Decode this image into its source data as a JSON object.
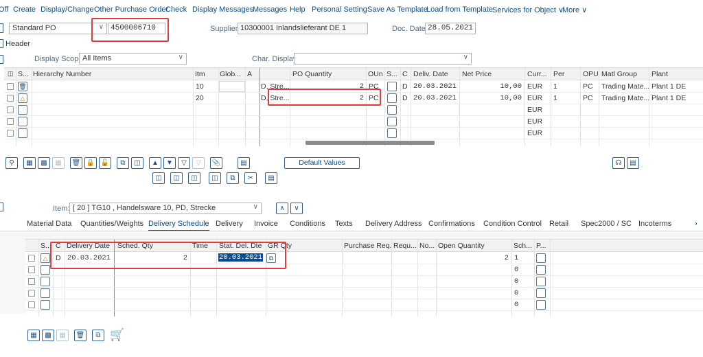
{
  "menu": {
    "off": "Off",
    "items": [
      "Create",
      "Display/Change",
      "Other Purchase Order",
      "Check",
      "Display Messages",
      "Messages",
      "Help",
      "Personal Setting",
      "Save As Template",
      "Load from Template",
      "Services for Object",
      "More"
    ]
  },
  "header": {
    "po_type": "Standard PO",
    "po_number": "4500006710",
    "supplier_label": "Supplier:",
    "supplier_value": "10300001 Inlandslieferant DE 1",
    "doc_date_label": "Doc. Date:",
    "doc_date_value": "28.05.2021",
    "header_label": "Header",
    "display_scope_label": "Display Scope:",
    "display_scope_value": "All Items",
    "char_display_label": "Char. Display:",
    "char_display_value": ""
  },
  "items_table": {
    "columns": [
      "S...",
      "Hierarchy Number",
      "Itm",
      "Glob...",
      "A",
      "PO Quantity",
      "OUn",
      "S...",
      "C",
      "Deliv. Date",
      "Net Price",
      "Curr...",
      "Per",
      "OPU",
      "Matl Group",
      "Plant"
    ],
    "rows": [
      {
        "status": "trash",
        "itm": "10",
        "a": "D, Stre...",
        "qty": "2",
        "oun": "PC",
        "c": "D",
        "date": "20.03.2021",
        "price": "10,00",
        "curr": "EUR",
        "per": "1",
        "opu": "PC",
        "matl": "Trading Mate...",
        "plant": "Plant 1 DE"
      },
      {
        "status": "warning",
        "itm": "20",
        "a": "D, Stre...",
        "qty": "2",
        "oun": "PC",
        "c": "D",
        "date": "20.03.2021",
        "price": "10,00",
        "curr": "EUR",
        "per": "1",
        "opu": "PC",
        "matl": "Trading Mate...",
        "plant": "Plant 1 DE"
      },
      {
        "status": "",
        "itm": "",
        "a": "",
        "qty": "",
        "oun": "",
        "c": "",
        "date": "",
        "price": "",
        "curr": "EUR",
        "per": "",
        "opu": "",
        "matl": "",
        "plant": ""
      },
      {
        "status": "",
        "itm": "",
        "a": "",
        "qty": "",
        "oun": "",
        "c": "",
        "date": "",
        "price": "",
        "curr": "EUR",
        "per": "",
        "opu": "",
        "matl": "",
        "plant": ""
      },
      {
        "status": "",
        "itm": "",
        "a": "",
        "qty": "",
        "oun": "",
        "c": "",
        "date": "",
        "price": "",
        "curr": "EUR",
        "per": "",
        "opu": "",
        "matl": "",
        "plant": ""
      }
    ]
  },
  "toolbar": {
    "default_values": "Default Values"
  },
  "item_detail": {
    "item_label": "Item:",
    "item_value": "[ 20 ] TG10 , Handelsware 10, PD, Strecke",
    "tabs": [
      "Material Data",
      "Quantities/Weights",
      "Delivery Schedule",
      "Delivery",
      "Invoice",
      "Conditions",
      "Texts",
      "Delivery Address",
      "Confirmations",
      "Condition Control",
      "Retail",
      "Spec2000 / SC",
      "Incoterms"
    ],
    "active_tab": "Delivery Schedule"
  },
  "schedule_table": {
    "columns": [
      "S...",
      "C",
      "Delivery Date",
      "Sched. Qty",
      "Time",
      "Stat. Del. Dte",
      "GR Qty",
      "Purchase Req.",
      "Requ...",
      "No...",
      "Open Quantity",
      "Sch...",
      "P..."
    ],
    "rows": [
      {
        "status": "warning",
        "c": "D",
        "date": "20.03.2021",
        "qty": "2",
        "stat": "20.03.2021",
        "open": "2",
        "sch": "1"
      },
      {
        "status": "",
        "c": "",
        "date": "",
        "qty": "",
        "stat": "",
        "open": "",
        "sch": "0"
      },
      {
        "status": "",
        "c": "",
        "date": "",
        "qty": "",
        "stat": "",
        "open": "",
        "sch": "0"
      },
      {
        "status": "",
        "c": "",
        "date": "",
        "qty": "",
        "stat": "",
        "open": "",
        "sch": "0"
      },
      {
        "status": "",
        "c": "",
        "date": "",
        "qty": "",
        "stat": "",
        "open": "",
        "sch": "0"
      }
    ]
  },
  "colors": {
    "accent": "#0a4d8c",
    "highlight": "#e03c3c",
    "selected_text_bg": "#0a4d8c"
  }
}
